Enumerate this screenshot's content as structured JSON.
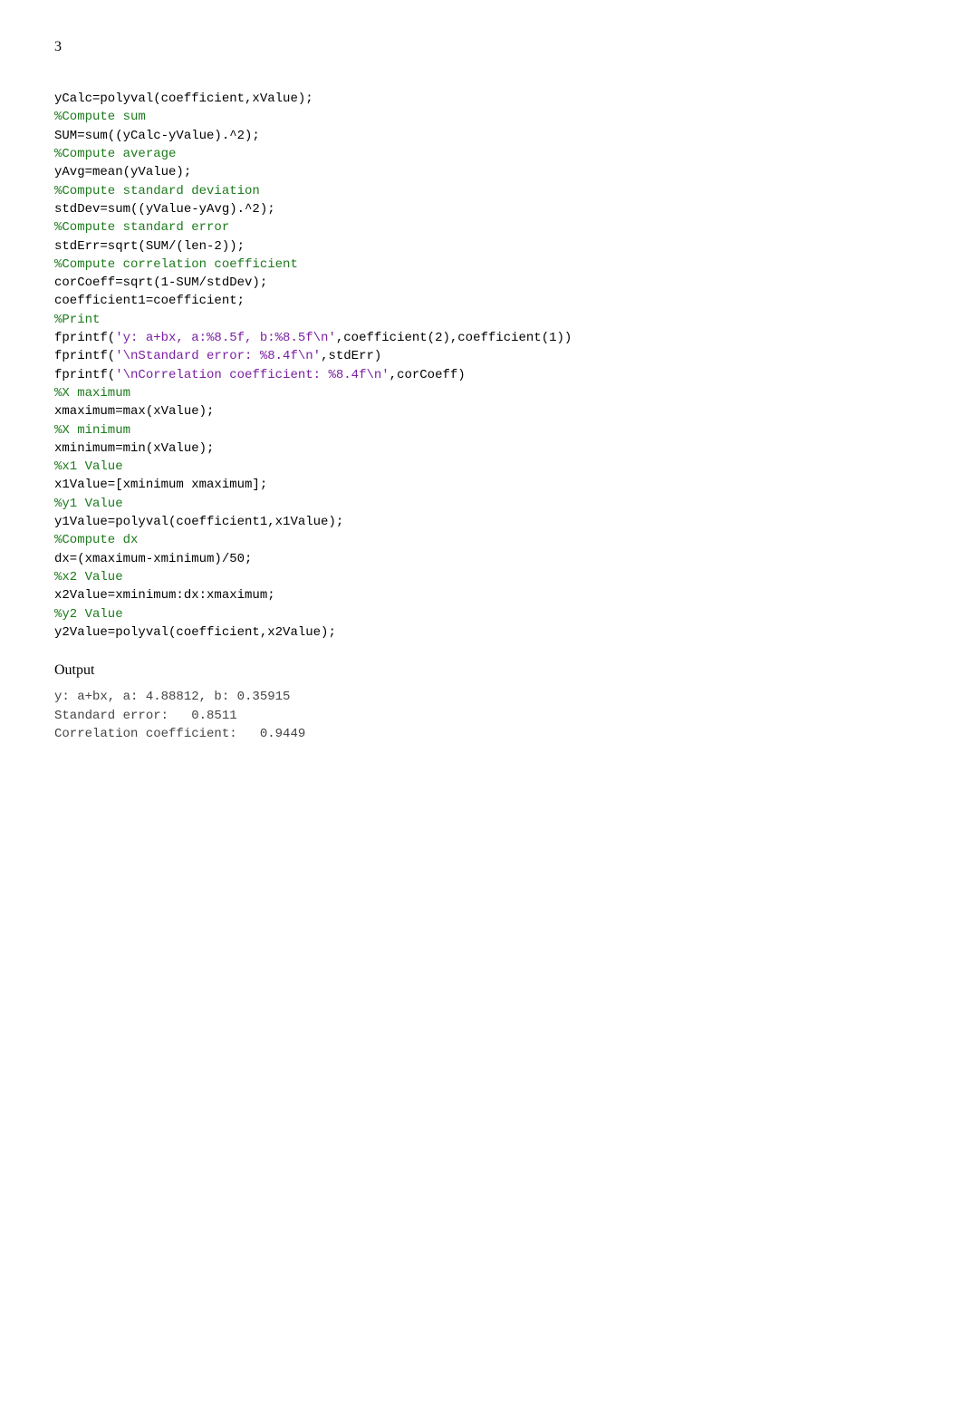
{
  "page_number": "3",
  "code_lines": [
    [
      {
        "cls": "plain",
        "text": "yCalc=polyval(coefficient,xValue);"
      }
    ],
    [
      {
        "cls": "comment",
        "text": "%Compute sum"
      }
    ],
    [
      {
        "cls": "plain",
        "text": "SUM=sum((yCalc-yValue).^2);"
      }
    ],
    [
      {
        "cls": "comment",
        "text": "%Compute average"
      }
    ],
    [
      {
        "cls": "plain",
        "text": "yAvg=mean(yValue);"
      }
    ],
    [
      {
        "cls": "comment",
        "text": "%Compute standard deviation"
      }
    ],
    [
      {
        "cls": "plain",
        "text": "stdDev=sum((yValue-yAvg).^2);"
      }
    ],
    [
      {
        "cls": "comment",
        "text": "%Compute standard error"
      }
    ],
    [
      {
        "cls": "plain",
        "text": "stdErr=sqrt(SUM/(len-2));"
      }
    ],
    [
      {
        "cls": "comment",
        "text": "%Compute correlation coefficient"
      }
    ],
    [
      {
        "cls": "plain",
        "text": "corCoeff=sqrt(1-SUM/stdDev);"
      }
    ],
    [
      {
        "cls": "plain",
        "text": "coefficient1=coefficient;"
      }
    ],
    [
      {
        "cls": "comment",
        "text": "%Print"
      }
    ],
    [
      {
        "cls": "plain",
        "text": "fprintf("
      },
      {
        "cls": "string",
        "text": "'y: a+bx, a:%8.5f, b:%8.5f\\n'"
      },
      {
        "cls": "plain",
        "text": ",coefficient(2),coefficient(1))"
      }
    ],
    [
      {
        "cls": "plain",
        "text": "fprintf("
      },
      {
        "cls": "string",
        "text": "'\\nStandard error: %8.4f\\n'"
      },
      {
        "cls": "plain",
        "text": ",stdErr)"
      }
    ],
    [
      {
        "cls": "plain",
        "text": "fprintf("
      },
      {
        "cls": "string",
        "text": "'\\nCorrelation coefficient: %8.4f\\n'"
      },
      {
        "cls": "plain",
        "text": ",corCoeff)"
      }
    ],
    [
      {
        "cls": "comment",
        "text": "%X maximum"
      }
    ],
    [
      {
        "cls": "plain",
        "text": "xmaximum=max(xValue);"
      }
    ],
    [
      {
        "cls": "comment",
        "text": "%X minimum"
      }
    ],
    [
      {
        "cls": "plain",
        "text": "xminimum=min(xValue);"
      }
    ],
    [
      {
        "cls": "comment",
        "text": "%x1 Value"
      }
    ],
    [
      {
        "cls": "plain",
        "text": "x1Value=[xminimum xmaximum];"
      }
    ],
    [
      {
        "cls": "comment",
        "text": "%y1 Value"
      }
    ],
    [
      {
        "cls": "plain",
        "text": "y1Value=polyval(coefficient1,x1Value);"
      }
    ],
    [
      {
        "cls": "comment",
        "text": "%Compute dx"
      }
    ],
    [
      {
        "cls": "plain",
        "text": "dx=(xmaximum-xminimum)/50;"
      }
    ],
    [
      {
        "cls": "comment",
        "text": "%x2 Value"
      }
    ],
    [
      {
        "cls": "plain",
        "text": "x2Value=xminimum:dx:xmaximum;"
      }
    ],
    [
      {
        "cls": "comment",
        "text": "%y2 Value"
      }
    ],
    [
      {
        "cls": "plain",
        "text": "y2Value=polyval(coefficient,x2Value);"
      }
    ]
  ],
  "output_heading": "Output",
  "output_lines": [
    "y: a+bx, a: 4.88812, b: 0.35915",
    "Standard error:   0.8511",
    "Correlation coefficient:   0.9449"
  ]
}
